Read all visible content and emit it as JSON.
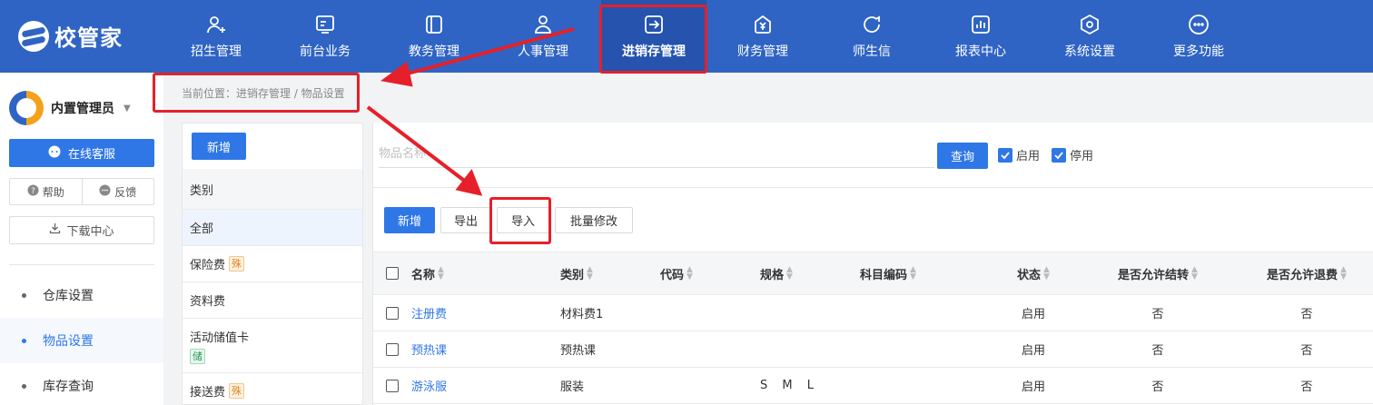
{
  "app": {
    "logo_text": "校管家",
    "brand_color": "#2f64c4",
    "accent_color": "#2f77e6",
    "annotation_color": "#e5202a"
  },
  "topnav": {
    "items": [
      {
        "label": "招生管理",
        "icon": "user-plus-icon"
      },
      {
        "label": "前台业务",
        "icon": "monitor-icon"
      },
      {
        "label": "教务管理",
        "icon": "book-icon"
      },
      {
        "label": "人事管理",
        "icon": "person-icon"
      },
      {
        "label": "进销存管理",
        "icon": "import-icon",
        "active": true
      },
      {
        "label": "财务管理",
        "icon": "yen-icon"
      },
      {
        "label": "师生信",
        "icon": "chat-icon"
      },
      {
        "label": "报表中心",
        "icon": "bar-report-icon"
      },
      {
        "label": "系统设置",
        "icon": "settings-hex-icon"
      },
      {
        "label": "更多功能",
        "icon": "more-dots-icon"
      }
    ]
  },
  "sidebar": {
    "user_name": "内置管理员",
    "service_label": "在线客服",
    "help_label": "帮助",
    "feedback_label": "反馈",
    "download_label": "下载中心",
    "menu": [
      {
        "label": "仓库设置"
      },
      {
        "label": "物品设置",
        "active": true
      },
      {
        "label": "库存查询"
      }
    ]
  },
  "breadcrumb": {
    "text": "当前位置：进销存管理 / 物品设置"
  },
  "category_panel": {
    "new_label": "新增",
    "header": "类别",
    "items": [
      {
        "label": "全部",
        "tag": null
      },
      {
        "label": "保险费",
        "tag": "殊",
        "tag_color": "orange"
      },
      {
        "label": "资料费",
        "tag": null
      },
      {
        "label": "活动储值卡",
        "tag": "储",
        "tag_color": "green"
      },
      {
        "label": "接送费",
        "tag": "殊",
        "tag_color": "orange"
      }
    ]
  },
  "filter": {
    "search_placeholder": "物品名称",
    "query_label": "查询",
    "enabled_label": "启用",
    "enabled_checked": true,
    "disabled_label": "停用",
    "disabled_checked": true
  },
  "toolbar": {
    "new_label": "新增",
    "export_label": "导出",
    "import_label": "导入",
    "batch_label": "批量修改"
  },
  "table": {
    "columns": [
      "名称",
      "类别",
      "代码",
      "规格",
      "科目编码",
      "状态",
      "是否允许结转",
      "是否允许退费"
    ],
    "rows": [
      {
        "name": "注册费",
        "category": "材料费1",
        "code": "",
        "spec": "",
        "subject": "",
        "status": "启用",
        "carry": "否",
        "refund": "否"
      },
      {
        "name": "预热课",
        "category": "预热课",
        "code": "",
        "spec": "",
        "subject": "",
        "status": "启用",
        "carry": "否",
        "refund": "否"
      },
      {
        "name": "游泳服",
        "category": "服装",
        "code": "",
        "spec": "S M L",
        "subject": "",
        "status": "启用",
        "carry": "否",
        "refund": "否"
      }
    ]
  }
}
